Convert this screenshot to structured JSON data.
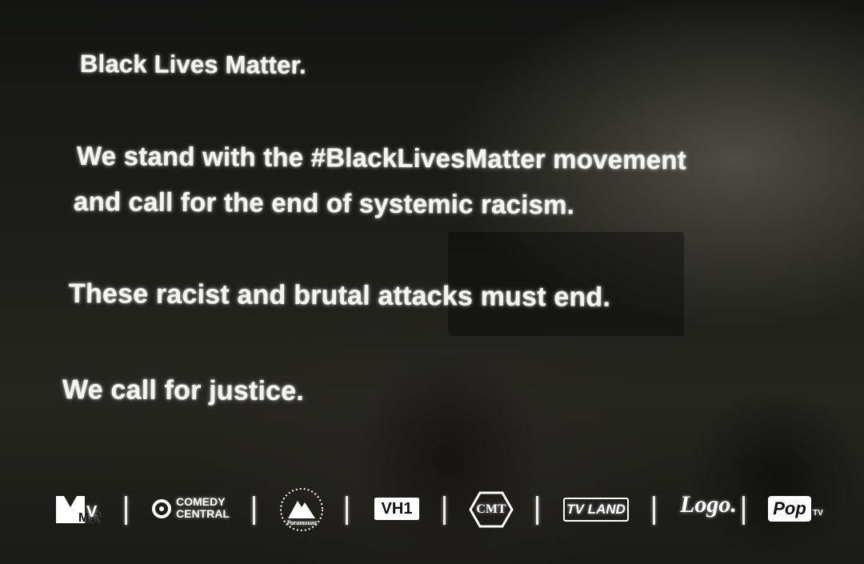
{
  "statement": {
    "line1": "Black Lives Matter.",
    "line2": "We stand with the #BlackLivesMatter movement",
    "line3": "and call for the end of systemic racism.",
    "line4": "These racist and brutal attacks must end.",
    "line5": "We call for justice."
  },
  "logos": {
    "mtv": "MTV",
    "comedy_central_line1": "COMEDY",
    "comedy_central_line2": "CENTRAL",
    "paramount": "Paramount",
    "vh1": "VH1",
    "cmt": "CMT",
    "tv_land": "TV LAND",
    "logo": "Logo.",
    "pop": "Pop",
    "pop_tv": "TV"
  },
  "colors": {
    "text": "#f4f4f0",
    "background": "#1d1d19"
  }
}
